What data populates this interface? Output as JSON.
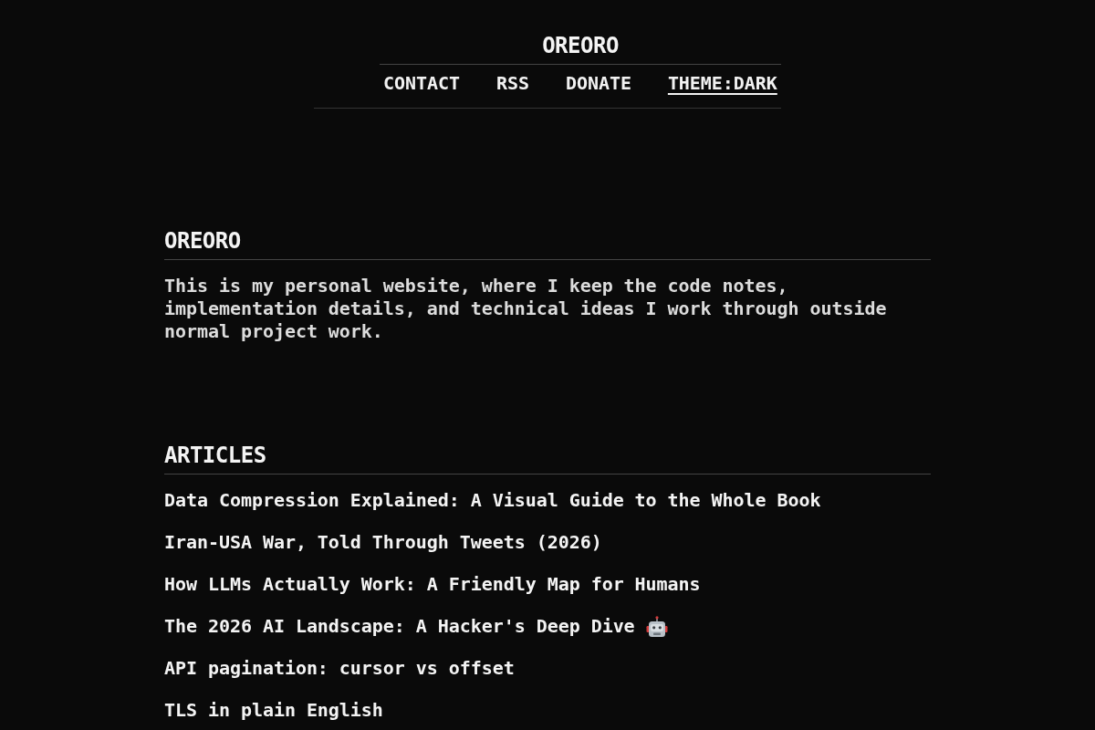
{
  "site_header": {
    "title": "OREORO",
    "nav": [
      {
        "label": "CONTACT",
        "active": false
      },
      {
        "label": "RSS",
        "active": false
      },
      {
        "label": "DONATE",
        "active": false
      },
      {
        "label": "THEME:DARK",
        "active": true
      }
    ]
  },
  "intro": {
    "heading": "OREORO",
    "text": "This is my personal website, where I keep the code notes, implementation details, and technical ideas I work through outside normal project work."
  },
  "articles": {
    "heading": "ARTICLES",
    "items": [
      {
        "title": "Data Compression Explained: A Visual Guide to the Whole Book",
        "robot_icon": false
      },
      {
        "title": "Iran-USA War, Told Through Tweets (2026)",
        "robot_icon": false
      },
      {
        "title": "How LLMs Actually Work: A Friendly Map for Humans",
        "robot_icon": false
      },
      {
        "title": "The 2026 AI Landscape: A Hacker's Deep Dive",
        "robot_icon": true
      },
      {
        "title": "API pagination: cursor vs offset",
        "robot_icon": false
      },
      {
        "title": "TLS in plain English",
        "robot_icon": false
      }
    ]
  }
}
